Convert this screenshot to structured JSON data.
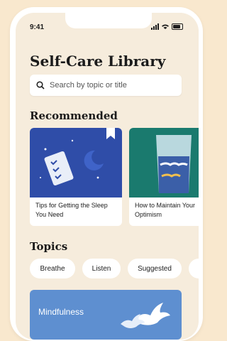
{
  "status_bar": {
    "time": "9:41"
  },
  "page": {
    "title": "Self-Care Library"
  },
  "search": {
    "placeholder": "Search by topic or title"
  },
  "sections": {
    "recommended": "Recommended",
    "topics": "Topics"
  },
  "recommended": [
    {
      "title": "Tips for Getting the Sleep You Need"
    },
    {
      "title": "How to Maintain Your Optimism"
    }
  ],
  "topics": [
    "Breathe",
    "Listen",
    "Suggested"
  ],
  "featured": {
    "label": "Mindfulness"
  },
  "colors": {
    "background": "#F9E8CE",
    "screen": "#F6ECDC",
    "card_sleep": "#2F4DA8",
    "card_optimism": "#1A7A6E",
    "banner": "#5E8FD0"
  },
  "icons": [
    "search-icon",
    "signal-icon",
    "wifi-icon",
    "battery-icon",
    "bookmark-icon",
    "moon-icon",
    "bird-icon"
  ]
}
